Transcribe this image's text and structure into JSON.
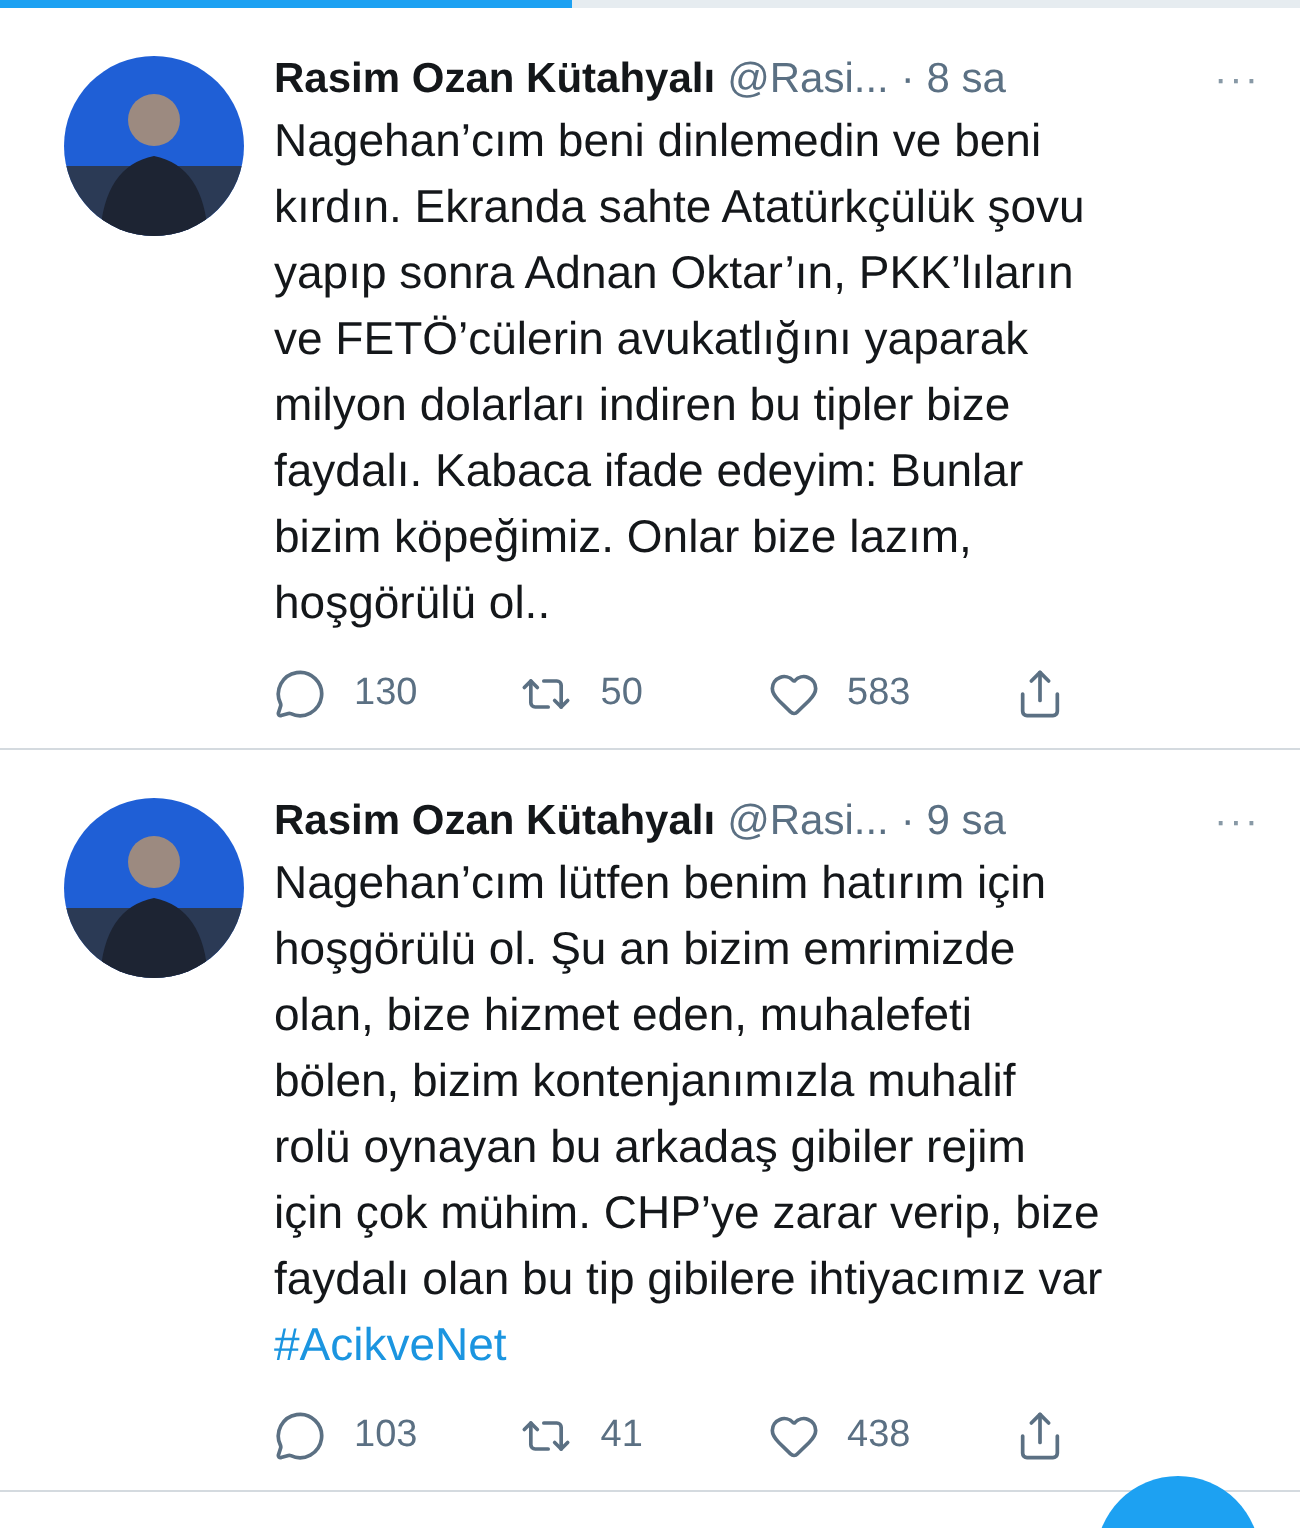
{
  "progress": {
    "level": 0.44
  },
  "tweets": [
    {
      "name": "Rasim Ozan Kütahyalı",
      "handle": "@Rasi...",
      "time": "· 8 sa",
      "more": "···",
      "lines": [
        "Nagehan’cım beni dinlemedin ve beni",
        "kırdın. Ekranda sahte Atatürkçülük şovu",
        "yapıp sonra Adnan Oktar’ın, PKK’lıların",
        "ve FETÖ’cülerin avukatlığını yaparak",
        "milyon dolarları indiren bu tipler bize",
        "faydalı. Kabaca ifade edeyim: Bunlar",
        "bizim köpeğimiz. Onlar bize lazım,",
        "hoşgörülü ol.."
      ],
      "replies": "130",
      "retweets": "50",
      "likes": "583"
    },
    {
      "name": "Rasim Ozan Kütahyalı",
      "handle": "@Rasi...",
      "time": "· 9 sa",
      "more": "···",
      "lines": [
        "Nagehan’cım lütfen benim hatırım için",
        "hoşgörülü ol. Şu an bizim emrimizde",
        "olan, bize hizmet eden, muhalefeti",
        "bölen, bizim kontenjanımızla muhalif",
        "rolü oynayan bu arkadaş gibiler rejim",
        "için çok mühim. CHP’ye zarar verip, bize",
        "faydalı olan bu tip gibilere ihtiyacımız var"
      ],
      "hashtag": "#AcikveNet",
      "replies": "103",
      "retweets": "41",
      "likes": "438"
    }
  ]
}
